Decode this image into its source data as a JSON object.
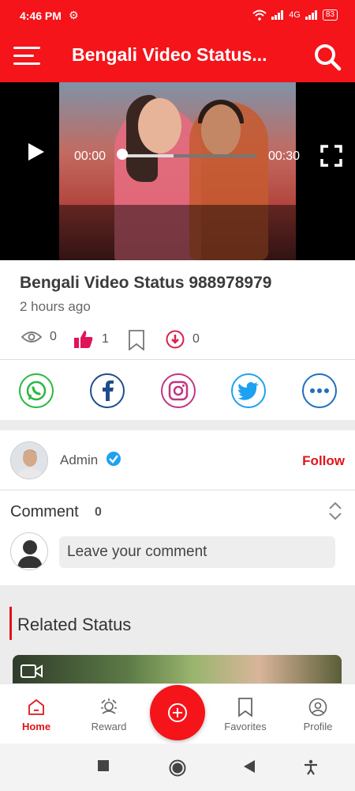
{
  "status_bar": {
    "time": "4:46 PM",
    "network_label": "4G",
    "battery": "83"
  },
  "app_bar": {
    "title": "Bengali Video Status..."
  },
  "player": {
    "current_time": "00:00",
    "duration": "00:30",
    "progress": 0.0,
    "buffered": 0.4
  },
  "video": {
    "title": "Bengali Video Status 988978979",
    "posted": "2 hours ago",
    "views": "0",
    "likes": "1",
    "downloads": "0"
  },
  "share": [
    "whatsapp-icon",
    "facebook-icon",
    "instagram-icon",
    "twitter-icon",
    "more-icon"
  ],
  "author": {
    "name": "Admin",
    "follow_label": "Follow"
  },
  "comments": {
    "heading": "Comment",
    "count": "0",
    "placeholder": "Leave your comment"
  },
  "related": {
    "heading": "Related Status"
  },
  "bottom_nav": [
    {
      "label": "Home",
      "active": true
    },
    {
      "label": "Reward",
      "active": false
    },
    {
      "label": "Favorites",
      "active": false
    },
    {
      "label": "Profile",
      "active": false
    }
  ],
  "colors": {
    "brand": "#f4141a",
    "follow": "#e0141a",
    "whatsapp": "#2bb741",
    "facebook": "#1f4d8a",
    "instagram": "#c13584",
    "twitter": "#1da1f2",
    "more": "#1f6fbf"
  }
}
